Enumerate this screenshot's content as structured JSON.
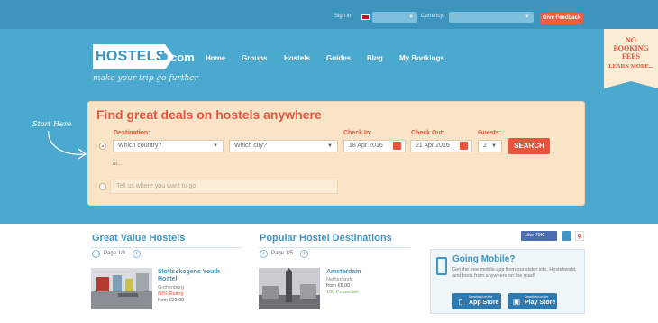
{
  "topbar": {
    "signin": "Sign in",
    "language_value": "English",
    "currency_label": "Currency:",
    "currency_value": "Euro",
    "feedback_label": "Give Feedback"
  },
  "brand": {
    "logo_text": "HOSTELS",
    "logo_suffix": "com",
    "tagline": "make your trip go further"
  },
  "nav": [
    "Home",
    "Groups",
    "Hostels",
    "Guides",
    "Blog",
    "My Bookings"
  ],
  "promo": {
    "line1": "NO",
    "line2": "BOOKING",
    "line3": "FEES",
    "link": "LEARN MORE..."
  },
  "start_here": "Start Here",
  "search": {
    "title": "Find great deals on hostels anywhere",
    "destination_label": "Destination:",
    "country_value": "Which country?",
    "city_value": "Which city?",
    "checkin_label": "Check In:",
    "checkin_value": "18 Apr 2016",
    "checkout_label": "Check Out:",
    "checkout_value": "21 Apr 2016",
    "guests_label": "Guests:",
    "guests_value": "2",
    "or_text": "or...",
    "free_placeholder": "Tell us where you want to go",
    "button": "SEARCH"
  },
  "great_value": {
    "title": "Great Value Hostels",
    "pager": "Page 1/3",
    "item": {
      "name": "Slottsskogens Youth Hostel",
      "city": "Gothenburg",
      "rating": "88% Rating",
      "price": "from €23.00"
    }
  },
  "popular": {
    "title": "Popular Hostel Destinations",
    "pager": "Page 1/5",
    "item": {
      "name": "Amsterdam",
      "country": "Netherlands",
      "price": "from €8.00",
      "properties": "100 Properties"
    }
  },
  "social": {
    "like": "Like 79K"
  },
  "mobile": {
    "title": "Going Mobile?",
    "text": "Get the free mobile app from our sister site, Hostelworld, and book from anywhere on the road!",
    "appstore_small": "Download on the",
    "appstore_big": "App Store",
    "play_small": "Download on the",
    "play_big": "Play Store"
  }
}
